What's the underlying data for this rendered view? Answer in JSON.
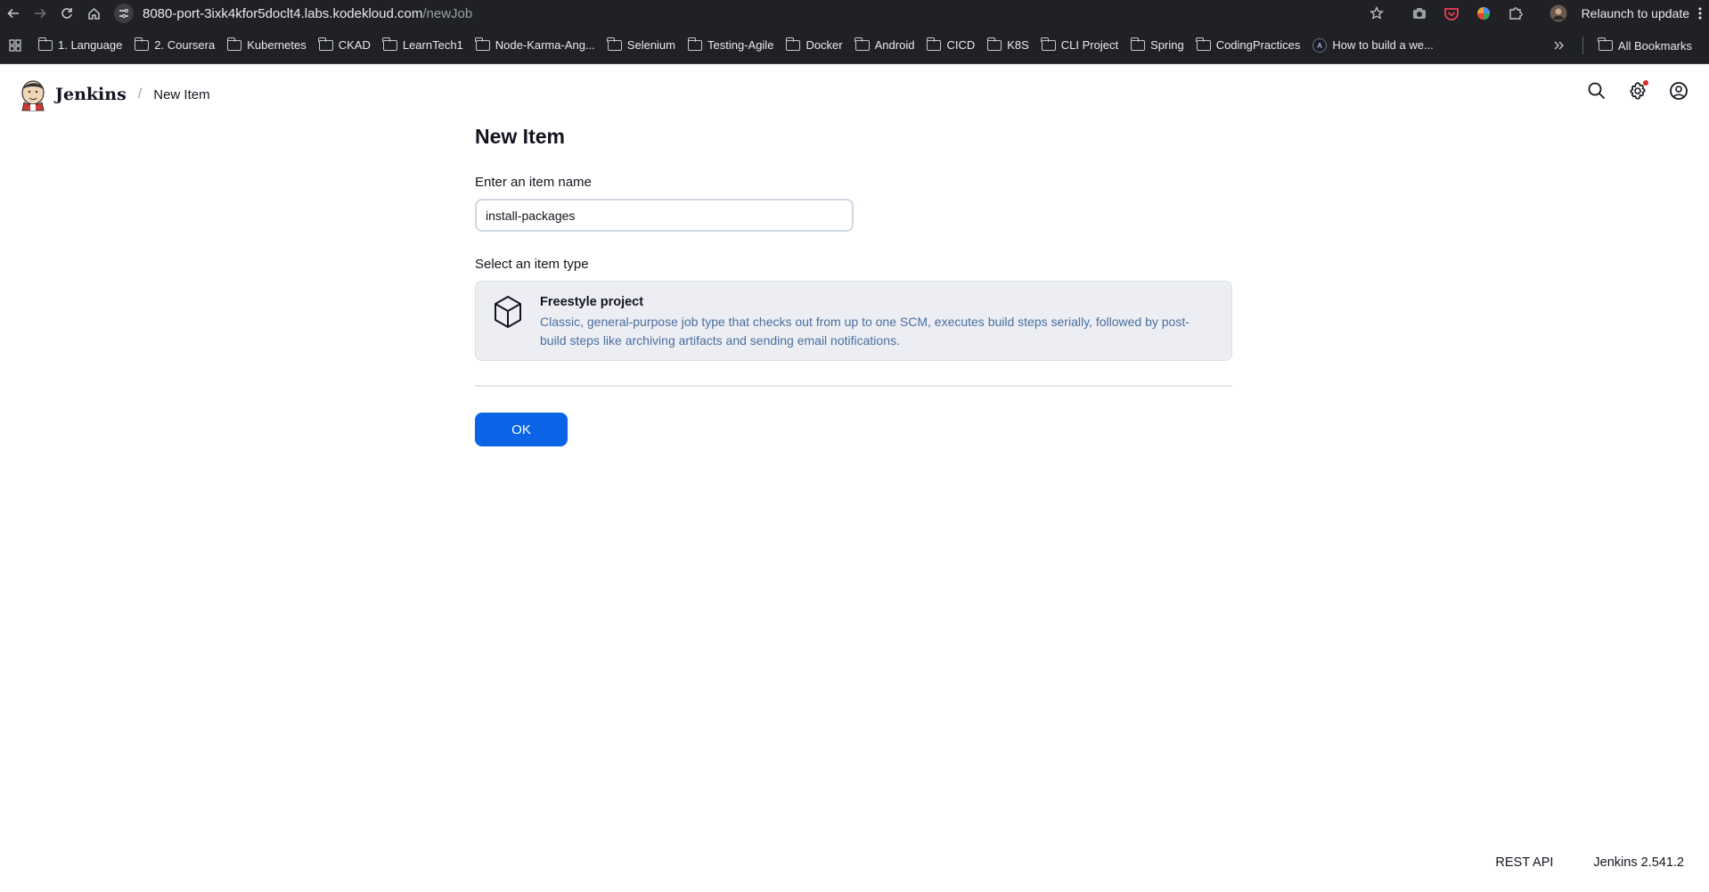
{
  "browser": {
    "url_host": "8080-port-3ixk4kfor5doclt4.labs.kodekloud.com",
    "url_path": "/newJob",
    "relaunch_label": "Relaunch to update",
    "bookmarks": [
      {
        "label": "1. Language",
        "icon": "folder-icon"
      },
      {
        "label": "2. Coursera",
        "icon": "folder-icon"
      },
      {
        "label": "Kubernetes",
        "icon": "folder-icon"
      },
      {
        "label": "CKAD",
        "icon": "folder-icon"
      },
      {
        "label": "LearnTech1",
        "icon": "folder-icon"
      },
      {
        "label": "Node-Karma-Ang...",
        "icon": "folder-icon"
      },
      {
        "label": "Selenium",
        "icon": "folder-icon"
      },
      {
        "label": "Testing-Agile",
        "icon": "folder-icon"
      },
      {
        "label": "Docker",
        "icon": "folder-icon"
      },
      {
        "label": "Android",
        "icon": "folder-icon"
      },
      {
        "label": "CICD",
        "icon": "folder-icon"
      },
      {
        "label": "K8S",
        "icon": "folder-icon"
      },
      {
        "label": "CLI Project",
        "icon": "folder-icon"
      },
      {
        "label": "Spring",
        "icon": "folder-icon"
      },
      {
        "label": "CodingPractices",
        "icon": "folder-icon"
      },
      {
        "label": "How to build a we...",
        "icon": "site-icon"
      }
    ],
    "all_bookmarks_label": "All Bookmarks"
  },
  "header": {
    "brand": "Jenkins",
    "breadcrumb": "New Item"
  },
  "main": {
    "title": "New Item",
    "name_label": "Enter an item name",
    "name_value": "install-packages",
    "type_label": "Select an item type",
    "item_types": [
      {
        "title": "Freestyle project",
        "description": "Classic, general-purpose job type that checks out from up to one SCM, executes build steps serially, followed by post-build steps like archiving artifacts and sending email notifications.",
        "icon": "package-icon"
      }
    ],
    "ok_label": "OK"
  },
  "footer": {
    "rest_api": "REST API",
    "version": "Jenkins 2.541.2"
  },
  "colors": {
    "primary": "#0b63e5",
    "card_bg": "#eceef3",
    "desc_text": "#4a6fa0"
  }
}
